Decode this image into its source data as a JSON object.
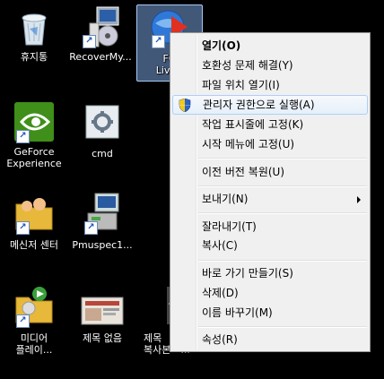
{
  "desktop": {
    "icons": [
      {
        "label": "휴지통",
        "icon": "recycle-bin-icon"
      },
      {
        "label": "RecoverMy...",
        "icon": "recovermyfiles-icon"
      },
      {
        "label": "FO",
        "label2": "LiveU",
        "icon": "liveupdate-icon"
      },
      {
        "label": "GeForce",
        "label2": "Experience",
        "icon": "geforce-icon"
      },
      {
        "label": "cmd",
        "icon": "cmd-icon"
      },
      {
        "label": "메신저 센터",
        "icon": "messenger-center-icon"
      },
      {
        "label": "Pmuspec1...",
        "icon": "installer-icon"
      },
      {
        "label": "미디어",
        "label2": "플레이...",
        "icon": "media-player-icon"
      },
      {
        "label": "제목 없음",
        "icon": "document-thumbnail-icon"
      },
      {
        "label": "제목",
        "label2": "복사본 - ...",
        "icon": "document-thumbnail-icon"
      }
    ]
  },
  "context_menu": {
    "items": [
      {
        "label": "열기(O)",
        "bold": true
      },
      {
        "label": "호환성 문제 해결(Y)"
      },
      {
        "label": "파일 위치 열기(I)"
      },
      {
        "label": "관리자 권한으로 실행(A)",
        "icon": "uac-shield-icon",
        "highlighted": true
      },
      {
        "label": "작업 표시줄에 고정(K)"
      },
      {
        "label": "시작 메뉴에 고정(U)"
      },
      {
        "label": "이전 버전 복원(U)"
      },
      {
        "label": "보내기(N)",
        "submenu": true
      },
      {
        "label": "잘라내기(T)"
      },
      {
        "label": "복사(C)"
      },
      {
        "label": "바로 가기 만들기(S)"
      },
      {
        "label": "삭제(D)"
      },
      {
        "label": "이름 바꾸기(M)"
      },
      {
        "label": "속성(R)"
      }
    ]
  },
  "colors": {
    "desktop_bg": "#000000",
    "menu_bg": "#f0f0f0",
    "highlight_border": "#aecff7"
  }
}
